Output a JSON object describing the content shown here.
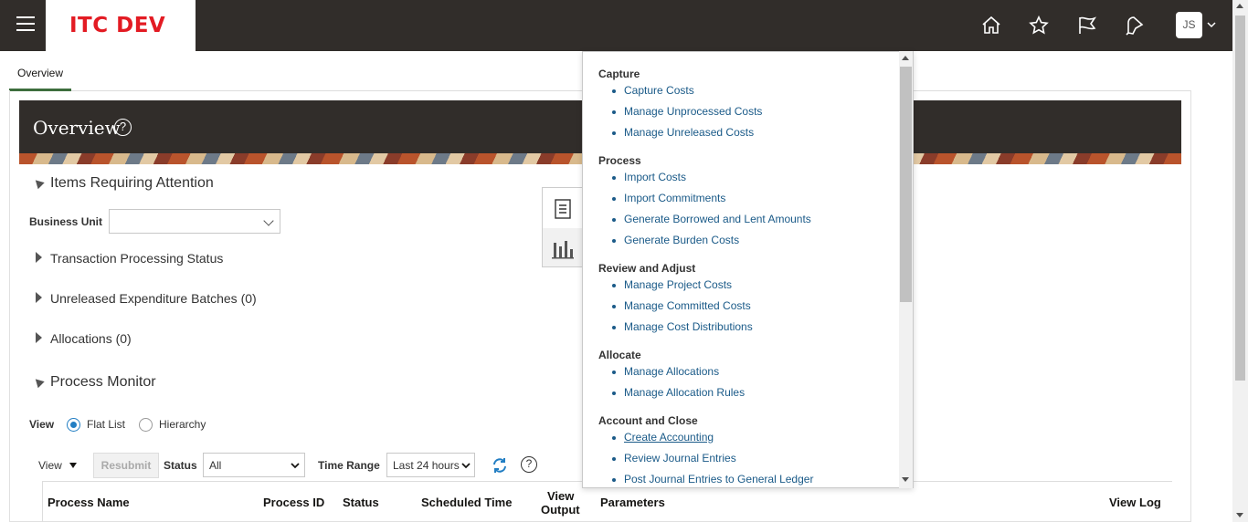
{
  "header": {
    "logo": "ITC DEV",
    "avatar_initials": "JS",
    "icons": [
      "menu-icon",
      "home-icon",
      "star-icon",
      "flag-icon",
      "notifications-icon",
      "chevron-down-icon"
    ]
  },
  "tabs": [
    {
      "label": "Overview"
    }
  ],
  "overview": {
    "title": "Overview",
    "help_glyph": "?",
    "items_requiring_attention": "Items Requiring Attention",
    "business_unit_label": "Business Unit",
    "business_unit_value": "",
    "sections": [
      {
        "label": "Transaction Processing Status"
      },
      {
        "label": "Unreleased Expenditure Batches (0)"
      },
      {
        "label": "Allocations (0)"
      }
    ],
    "process_monitor": {
      "title": "Process Monitor",
      "view_label": "View",
      "radio_options": [
        {
          "label": "Flat List",
          "selected": true
        },
        {
          "label": "Hierarchy",
          "selected": false
        }
      ],
      "toolbar": {
        "view_menu": "View",
        "resubmit": "Resubmit",
        "status_label": "Status",
        "status_value": "All",
        "time_range_label": "Time Range",
        "time_range_value": "Last 24 hours",
        "help_glyph": "?"
      },
      "columns": [
        "Process Name",
        "Process ID",
        "Status",
        "Scheduled Time",
        "View",
        "Output",
        "Parameters",
        "View Log"
      ]
    }
  },
  "tasks_menu": {
    "groups": [
      {
        "title": "Capture",
        "items": [
          "Capture Costs",
          "Manage Unprocessed Costs",
          "Manage Unreleased Costs"
        ]
      },
      {
        "title": "Process",
        "items": [
          "Import Costs",
          "Import Commitments",
          "Generate Borrowed and Lent Amounts",
          "Generate Burden Costs"
        ]
      },
      {
        "title": "Review and Adjust",
        "items": [
          "Manage Project Costs",
          "Manage Committed Costs",
          "Manage Cost Distributions"
        ]
      },
      {
        "title": "Allocate",
        "items": [
          "Manage Allocations",
          "Manage Allocation Rules"
        ]
      },
      {
        "title": "Account and Close",
        "items": [
          "Create Accounting",
          "Review Journal Entries",
          "Post Journal Entries to General Ledger"
        ]
      }
    ]
  },
  "colors": {
    "header_bg": "#312d2a",
    "logo_red": "#e31b23",
    "link": "#1a5a88",
    "tab_underline": "#3d6e3d",
    "radio_selected": "#227ec3"
  }
}
